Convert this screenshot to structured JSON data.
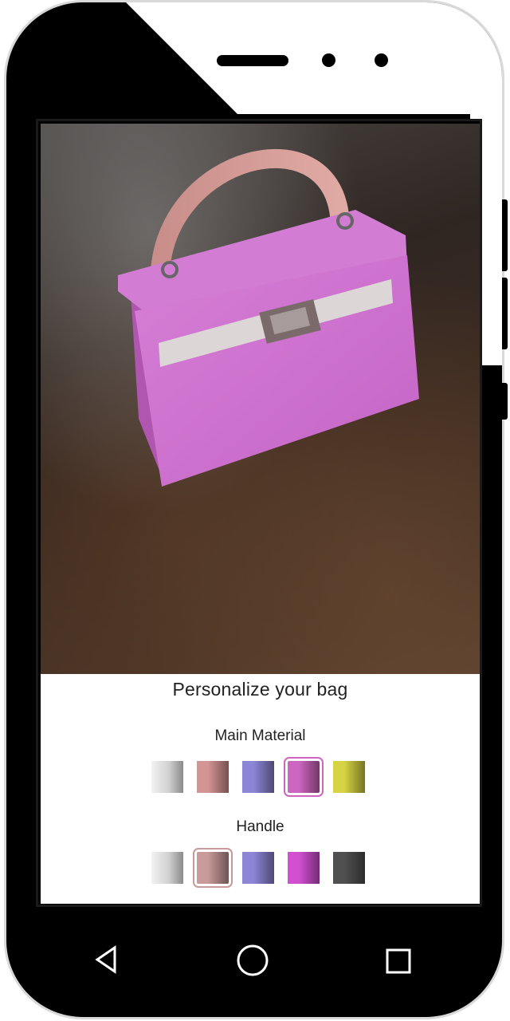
{
  "panel": {
    "title": "Personalize your bag",
    "main_material": {
      "label": "Main Material",
      "swatches": [
        {
          "name": "white",
          "color": "#d8d8d8",
          "selected": false
        },
        {
          "name": "rose",
          "color": "#d49494",
          "selected": false
        },
        {
          "name": "lavender",
          "color": "#8c86d6",
          "selected": false
        },
        {
          "name": "orchid",
          "color": "#cd66c0",
          "selected": true
        },
        {
          "name": "yellow",
          "color": "#d6d444",
          "selected": false
        }
      ]
    },
    "handle": {
      "label": "Handle",
      "swatches": [
        {
          "name": "white",
          "color": "#d8d8d8",
          "selected": false
        },
        {
          "name": "dusty-rose",
          "color": "#c89a9a",
          "selected": true
        },
        {
          "name": "lavender",
          "color": "#8c86d6",
          "selected": false
        },
        {
          "name": "magenta",
          "color": "#d24fd2",
          "selected": false
        },
        {
          "name": "charcoal",
          "color": "#505050",
          "selected": false
        }
      ]
    }
  },
  "navbar": {
    "back_icon": "triangle-back-icon",
    "home_icon": "circle-home-icon",
    "recents_icon": "square-recents-icon"
  }
}
